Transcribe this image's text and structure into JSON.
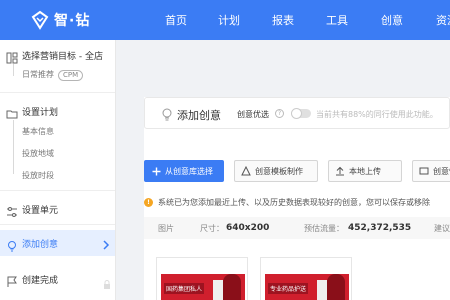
{
  "logo": {
    "text": "智·钻"
  },
  "nav": [
    "首页",
    "计划",
    "报表",
    "工具",
    "创意",
    "资源"
  ],
  "sidebar": {
    "target": "选择营销目标 - 全店",
    "target_sub": "日常推荐",
    "cpm": "CPM",
    "plan": "设置计划",
    "plan_items": [
      "基本信息",
      "投放地域",
      "投放时段"
    ],
    "unit": "设置单元",
    "creative": "添加创意",
    "done": "创建完成"
  },
  "creative": {
    "title": "添加创意",
    "opt_label": "创意优选",
    "opt_desc": "当前共有88%的同行使用此功能。",
    "help": "?"
  },
  "buttons": {
    "from_library": "从创意库选择",
    "template": "创意模板制作",
    "upload": "本地上传",
    "quick": "创意快"
  },
  "notice": "系统已为您添加最近上传、以及历史数据表现较好的创意，您可以保存或移除",
  "info": {
    "image_label": "图片",
    "size_label": "尺寸：",
    "size_value": "640x200",
    "traffic_label": "预估流量：",
    "traffic_value": "452,372,535",
    "suggest_label": "建议"
  },
  "thumbs": [
    {
      "caption": "国药集团私人"
    },
    {
      "caption": "专业药品护送"
    }
  ],
  "colors": {
    "brand": "#3b7cf4",
    "warning": "#f5a623",
    "ad_red": "#d01f2d"
  }
}
